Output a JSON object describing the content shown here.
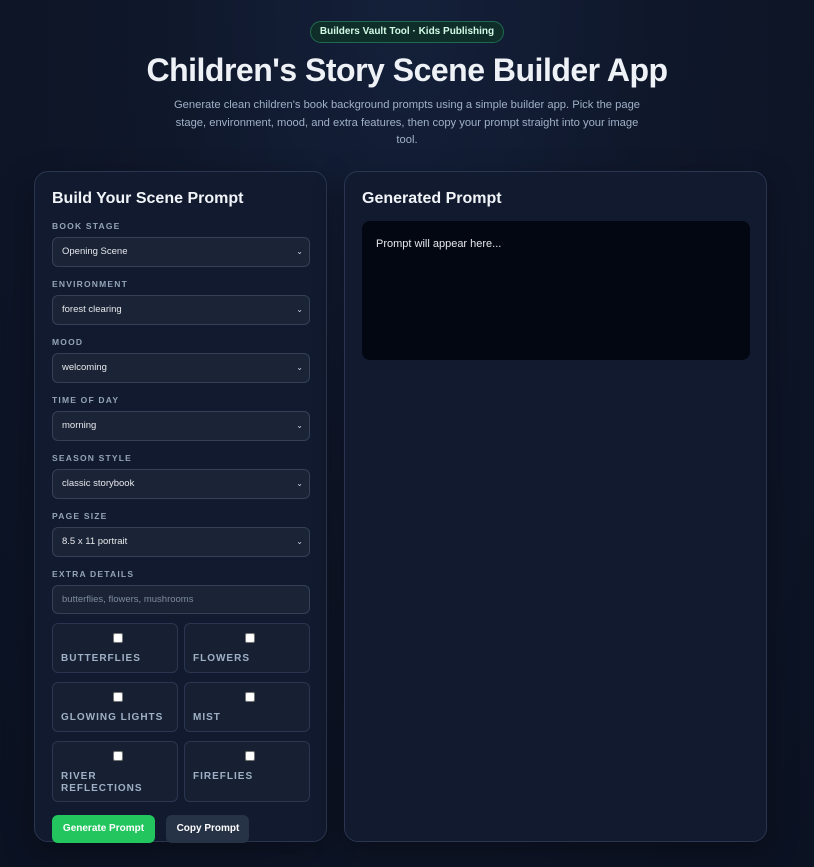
{
  "header": {
    "badge": "Builders Vault Tool · Kids Publishing",
    "title": "Children's Story Scene Builder App",
    "subtitle": "Generate clean children's book background prompts using a simple builder app. Pick the page stage, environment, mood, and extra features, then copy your prompt straight into your image tool."
  },
  "builder": {
    "title": "Build Your Scene Prompt",
    "book_stage": {
      "label": "BOOK STAGE",
      "value": "Opening Scene"
    },
    "environment": {
      "label": "ENVIRONMENT",
      "value": "forest clearing"
    },
    "mood": {
      "label": "MOOD",
      "value": "welcoming"
    },
    "time_of_day": {
      "label": "TIME OF DAY",
      "value": "morning"
    },
    "season_style": {
      "label": "SEASON STYLE",
      "value": "classic storybook"
    },
    "page_size": {
      "label": "PAGE SIZE",
      "value": "8.5 x 11 portrait"
    },
    "extra_details": {
      "label": "EXTRA DETAILS",
      "placeholder": "butterflies, flowers, mushrooms",
      "value": ""
    },
    "checkboxes": [
      {
        "label": "BUTTERFLIES",
        "checked": false
      },
      {
        "label": "FLOWERS",
        "checked": false
      },
      {
        "label": "GLOWING LIGHTS",
        "checked": false
      },
      {
        "label": "MIST",
        "checked": false
      },
      {
        "label": "RIVER REFLECTIONS",
        "checked": false
      },
      {
        "label": "FIREFLIES",
        "checked": false
      }
    ],
    "generate_label": "Generate Prompt",
    "copy_label": "Copy Prompt"
  },
  "output": {
    "title": "Generated Prompt",
    "placeholder": "Prompt will appear here..."
  },
  "colors": {
    "accent": "#22c55e",
    "background": "#0f172a",
    "panel": "#111a2e",
    "output_bg": "#030712"
  },
  "icons": {
    "select_arrow": "chevron-down-icon"
  }
}
